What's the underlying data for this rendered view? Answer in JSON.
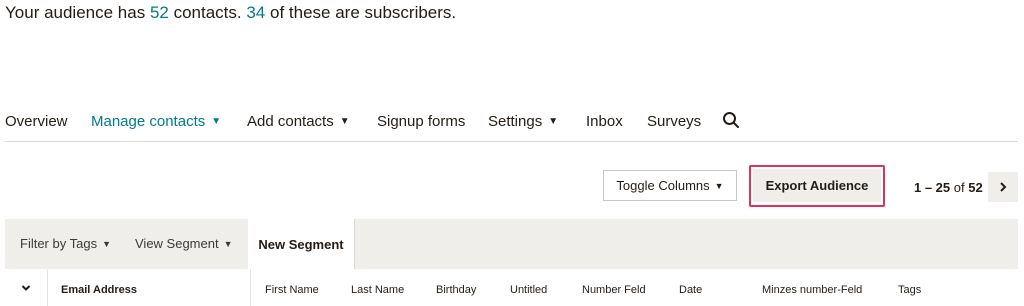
{
  "summary": {
    "prefix": "Your audience has ",
    "contacts_count": "52",
    "middle": " contacts. ",
    "subscribers_count": "34",
    "suffix": " of these are subscribers."
  },
  "nav": {
    "overview": "Overview",
    "manage_contacts": "Manage contacts",
    "add_contacts": "Add contacts",
    "signup_forms": "Signup forms",
    "settings": "Settings",
    "inbox": "Inbox",
    "surveys": "Surveys"
  },
  "toolbar": {
    "toggle_columns": "Toggle Columns",
    "export_audience": "Export Audience"
  },
  "pager": {
    "range": "1 – 25",
    "of": " of ",
    "total": "52"
  },
  "filters": {
    "filter_by_tags": "Filter by Tags",
    "view_segment": "View Segment",
    "new_segment": "New Segment"
  },
  "table": {
    "columns": [
      "Email Address",
      "First Name",
      "Last Name",
      "Birthday",
      "Untitled",
      "Number Feld",
      "Date",
      "Minzes number-Feld",
      "Tags"
    ]
  },
  "colors": {
    "accent": "#007c89",
    "highlight": "#e0315c",
    "neutral_bg": "#efeeea"
  }
}
